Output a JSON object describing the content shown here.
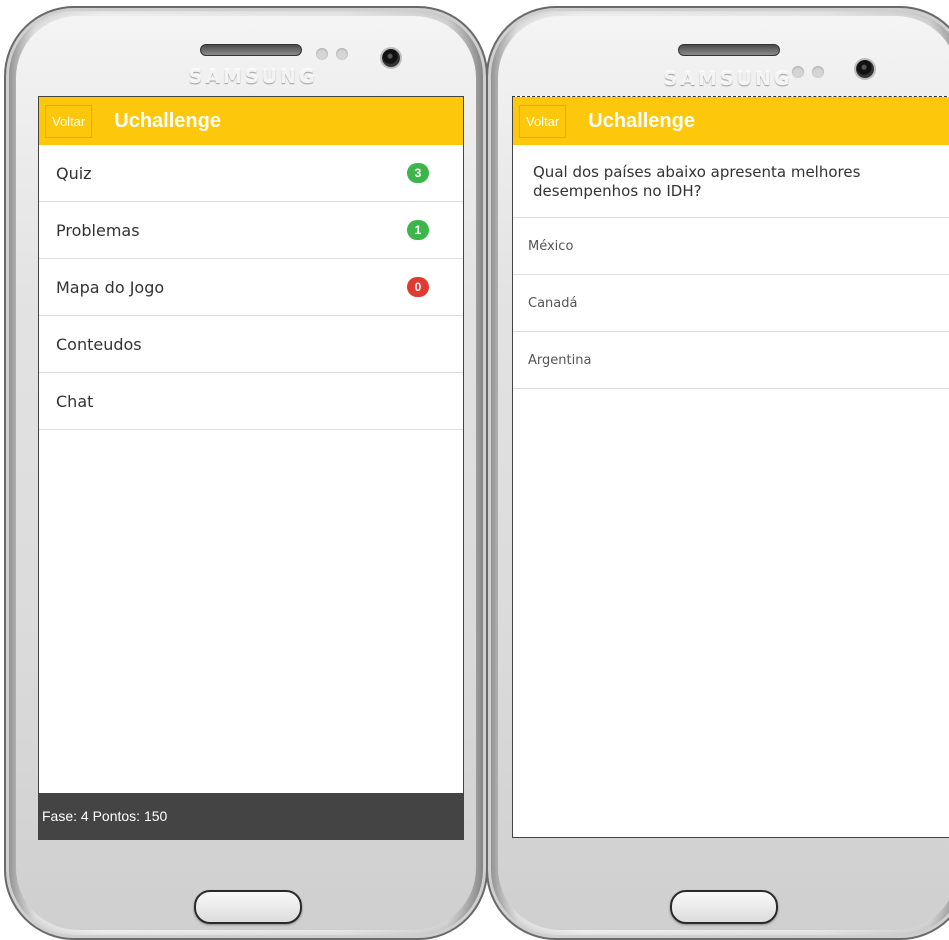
{
  "device": {
    "brand": "SAMSUNG"
  },
  "left_screen": {
    "back_label": "Voltar",
    "title": "Uchallenge",
    "menu": [
      {
        "label": "Quiz",
        "badge": "3",
        "badge_color": "#3cb54a"
      },
      {
        "label": "Problemas",
        "badge": "1",
        "badge_color": "#3cb54a"
      },
      {
        "label": "Mapa do Jogo",
        "badge": "0",
        "badge_color": "#e03b32"
      },
      {
        "label": "Conteudos"
      },
      {
        "label": "Chat"
      }
    ],
    "footer": "Fase: 4 Pontos: 150"
  },
  "right_screen": {
    "back_label": "Voltar",
    "title": "Uchallenge",
    "question": "Qual dos países abaixo apresenta melhores desempenhos no IDH?",
    "options": [
      "México",
      "Canadá",
      "Argentina"
    ]
  },
  "colors": {
    "accent": "#fdc70b",
    "footer": "#444444"
  },
  "icons": [
    "menu-icon",
    "back-arrow-icon",
    "home-button"
  ]
}
